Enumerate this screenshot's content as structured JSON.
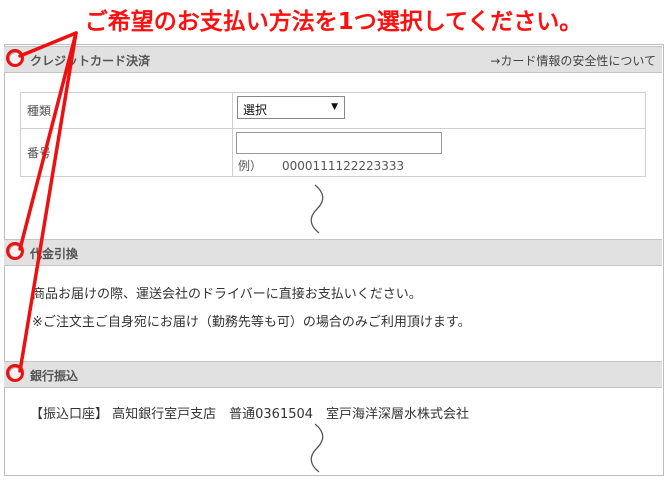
{
  "instruction": "ご希望のお支払い方法を1つ選択してください。",
  "credit": {
    "title": "クレジットカード決済",
    "security_link": "→カード情報の安全性について",
    "type_label": "種類",
    "type_value": "選択",
    "number_label": "番号",
    "number_value": "",
    "example_prefix": "例）",
    "example_number": "0000111122223333"
  },
  "cod": {
    "title": "代金引換",
    "line1": "商品お届けの際、運送会社のドライバーに直接お支払いください。",
    "line2": "※ご注文主ご自身宛にお届け（勤務先等も可）の場合のみご利用頂けます。"
  },
  "bank": {
    "title": "銀行振込",
    "account": "【振込口座】 高知銀行室戸支店　普通0361504　室戸海洋深層水株式会社"
  },
  "colors": {
    "accent": "#ee1010",
    "bar": "#e1e1e1"
  }
}
